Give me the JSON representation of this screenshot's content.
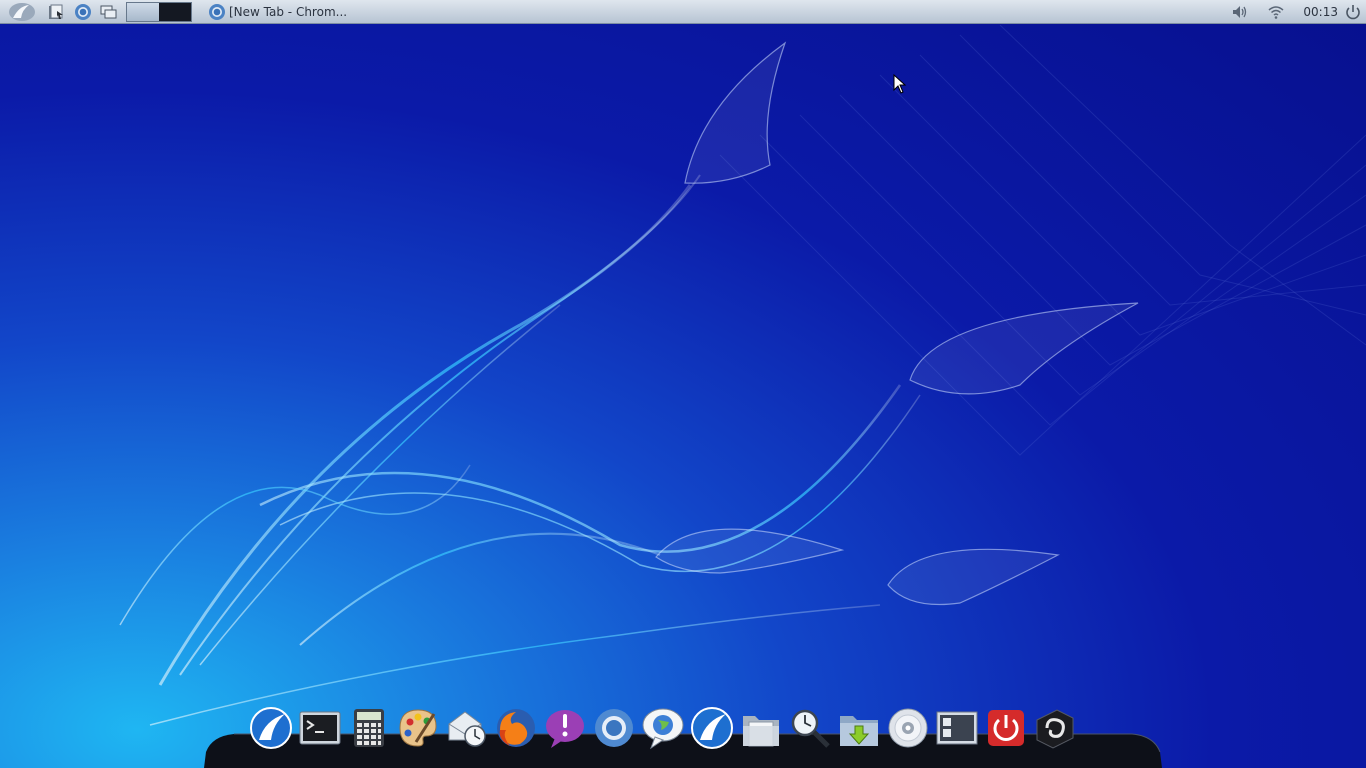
{
  "top_panel": {
    "menu_icon": "lubuntu-logo-icon",
    "launchers": [
      {
        "name": "file-manager-launcher",
        "icon": "file-manager-icon"
      },
      {
        "name": "browser-launcher",
        "icon": "chromium-icon"
      },
      {
        "name": "show-desktop-launcher",
        "icon": "windows-icon"
      }
    ],
    "pager": {
      "desktops": 2,
      "active": 1
    },
    "taskbar": {
      "label": "[New Tab - Chrom...",
      "icon": "chromium-icon"
    },
    "tray": {
      "volume_icon": "speaker-icon",
      "network_icon": "wifi-icon",
      "clock": "00:13",
      "power_icon": "power-icon"
    }
  },
  "dock": {
    "items": [
      {
        "name": "lubuntu-menu",
        "icon": "lubuntu-icon"
      },
      {
        "name": "terminal",
        "icon": "terminal-icon"
      },
      {
        "name": "calculator",
        "icon": "calculator-icon"
      },
      {
        "name": "paint",
        "icon": "palette-icon"
      },
      {
        "name": "mail-scheduler",
        "icon": "mail-clock-icon"
      },
      {
        "name": "firefox",
        "icon": "firefox-icon"
      },
      {
        "name": "pidgin",
        "icon": "chat-bubble-icon"
      },
      {
        "name": "chromium",
        "icon": "chromium-icon"
      },
      {
        "name": "web-chat",
        "icon": "globe-bubble-icon"
      },
      {
        "name": "lubuntu-settings",
        "icon": "lubuntu-icon"
      },
      {
        "name": "file-manager",
        "icon": "folder-docs-icon"
      },
      {
        "name": "search",
        "icon": "magnifier-clock-icon"
      },
      {
        "name": "downloads",
        "icon": "download-folder-icon"
      },
      {
        "name": "disc-burner",
        "icon": "cd-icon"
      },
      {
        "name": "system-monitor",
        "icon": "monitor-icon"
      },
      {
        "name": "shutdown",
        "icon": "power-button-icon"
      },
      {
        "name": "media-player",
        "icon": "swirl-icon"
      }
    ]
  },
  "colors": {
    "wallpaper_dark": "#07108e",
    "wallpaper_light": "#1fb6f2",
    "panel_top": "#dfe6ee",
    "panel_bottom": "#b7c4d3"
  }
}
